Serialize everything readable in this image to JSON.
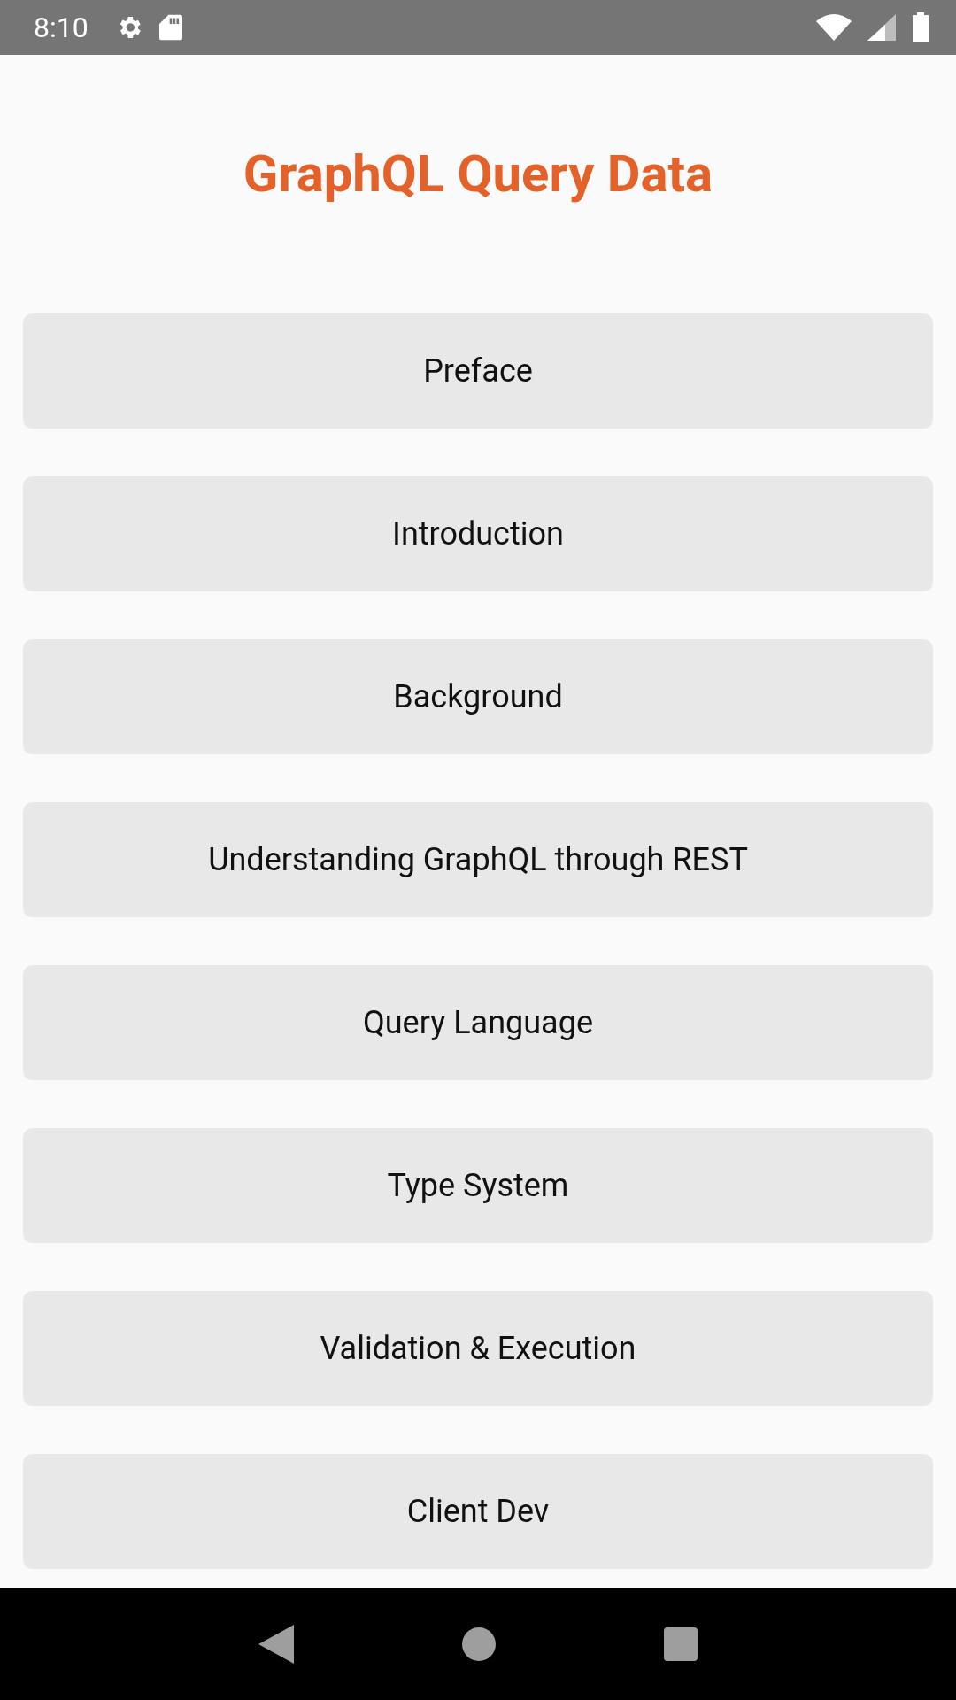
{
  "status_bar": {
    "time": "8:10"
  },
  "title": "GraphQL Query Data",
  "chapters": [
    {
      "label": "Preface"
    },
    {
      "label": "Introduction"
    },
    {
      "label": "Background"
    },
    {
      "label": "Understanding GraphQL through REST"
    },
    {
      "label": "Query Language"
    },
    {
      "label": "Type System"
    },
    {
      "label": "Validation & Execution"
    },
    {
      "label": "Client Dev"
    }
  ]
}
